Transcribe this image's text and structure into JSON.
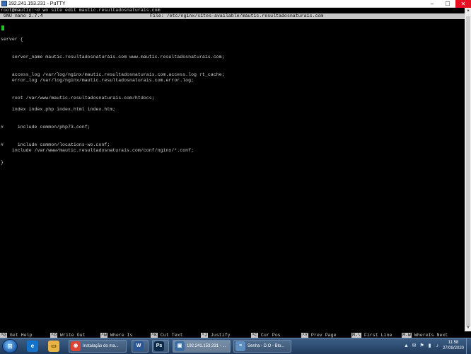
{
  "window": {
    "title": "192.241.153.231 - PuTTY",
    "controls": [
      "–",
      "☐",
      "✕"
    ]
  },
  "terminal": {
    "prompt_line": "root@mautic:~# wo site edit mautic.resultadosnaturais.com",
    "nano_version": "GNU nano 2.7.4",
    "nano_file": "File: /etc/nginx/sites-available/mautic.resultadosnaturais.com",
    "lines": [
      {
        "row": 5,
        "text": "server {"
      },
      {
        "row": 8,
        "text": "    server_name mautic.resultadosnaturais.com www.mautic.resultadosnaturais.com;"
      },
      {
        "row": 11,
        "text": "    access_log /var/log/nginx/mautic.resultadosnaturais.com.access.log rt_cache;"
      },
      {
        "row": 12,
        "text": "    error_log /var/log/nginx/mautic.resultadosnaturais.com.error.log;"
      },
      {
        "row": 15,
        "text": "    root /var/www/mautic.resultadosnaturais.com/htdocs;"
      },
      {
        "row": 17,
        "text": "    index index.php index.html index.htm;"
      },
      {
        "row": 20,
        "text": "#     include common/php73.conf;"
      },
      {
        "row": 23,
        "text": "#     include common/locations-wo.conf;"
      },
      {
        "row": 24,
        "text": "    include /var/www/mautic.resultadosnaturais.com/conf/nginx/*.conf;"
      },
      {
        "row": 26,
        "text": "}"
      }
    ],
    "help_items": [
      {
        "key": "^G",
        "label": "Get Help"
      },
      {
        "key": "^O",
        "label": "Write Out"
      },
      {
        "key": "^W",
        "label": "Where Is"
      },
      {
        "key": "^K",
        "label": "Cut Text"
      },
      {
        "key": "^J",
        "label": "Justify"
      },
      {
        "key": "^C",
        "label": "Cur Pos"
      },
      {
        "key": "^Y",
        "label": "Prev Page"
      },
      {
        "key": "M-\\",
        "label": "First Line"
      },
      {
        "key": "M-W",
        "label": "WhereIs Next"
      }
    ]
  },
  "taskbar": {
    "items": [
      {
        "label": "Instalação do ma...",
        "color": "#db4437",
        "glyph": "◉"
      },
      {
        "label": "",
        "color": "#2b5797",
        "glyph": "W"
      },
      {
        "label": "",
        "color": "#0b2a4a",
        "glyph": "Ps"
      },
      {
        "label": "192.241.153.231 - ...",
        "color": "#3a6ea5",
        "glyph": "▣"
      },
      {
        "label": "Senha - D.O - Blo...",
        "color": "#5f8ec0",
        "glyph": "≡"
      }
    ],
    "tray_icons": [
      "▲",
      "✉",
      "⚑",
      "▮",
      "♪"
    ],
    "time": "11:58",
    "date": "27/09/2020"
  },
  "colors": {
    "terminal_bg": "#000000",
    "terminal_fg": "#cfcfcf",
    "cursor": "#22c322",
    "nano_bar": "#c8c8c8"
  }
}
